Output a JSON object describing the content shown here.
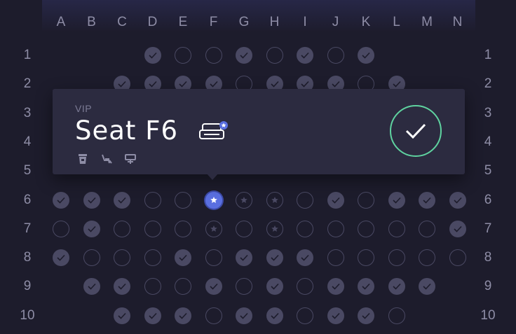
{
  "columns": [
    "A",
    "B",
    "C",
    "D",
    "E",
    "F",
    "G",
    "H",
    "I",
    "J",
    "K",
    "L",
    "M",
    "N"
  ],
  "rows": [
    "1",
    "2",
    "3",
    "4",
    "5",
    "6",
    "7",
    "8",
    "9",
    "10"
  ],
  "seat_map": [
    "...TEETETET...",
    "..TTTTETTTET..",
    "..............",
    "..............",
    "..............",
    "TTTEESVVETETTT",
    "ETEEEVEVEEEEET",
    "TEEETETTTEEEEE",
    ".TTEETETETTTT.",
    "..TTTETTETTE.."
  ],
  "seat_legend": {
    "T": "taken",
    "E": "available",
    "V": "vip-available",
    "S": "selected"
  },
  "popover": {
    "tier": "VIP",
    "title": "Seat F6",
    "amenities": [
      "drink-icon",
      "recliner-icon",
      "tray-table-icon"
    ]
  },
  "colors": {
    "background": "#1d1c2c",
    "panel": "#2c2b40",
    "taken": "#4a4963",
    "selected": "#5a6fe0",
    "confirm": "#5fd3a0"
  }
}
